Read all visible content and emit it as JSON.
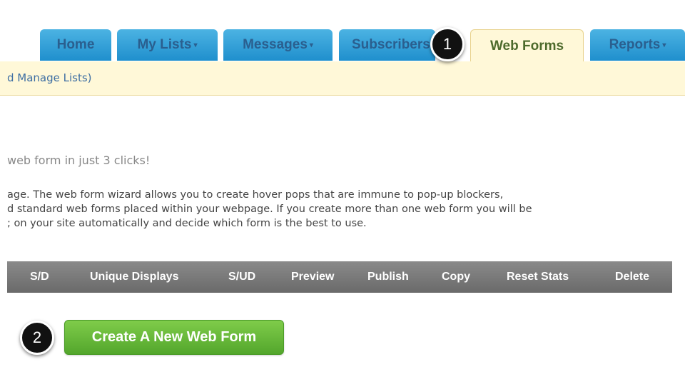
{
  "nav": {
    "tabs": [
      {
        "label": "Home"
      },
      {
        "label": "My Lists"
      },
      {
        "label": "Messages"
      },
      {
        "label": "Subscribers"
      },
      {
        "label": "Web Forms"
      },
      {
        "label": "Reports"
      }
    ],
    "caret": "▾",
    "subnav_text": "d Manage Lists)"
  },
  "content": {
    "heading": "web form in just 3 clicks!",
    "description_lines": [
      "age. The web form wizard allows you to create hover pops that are immune to pop-up blockers,",
      "d standard web forms placed within your webpage. If you create more than one web form you will be",
      "; on your site automatically and decide which form is the best to use."
    ]
  },
  "table": {
    "columns": [
      "S/D",
      "Unique Displays",
      "S/UD",
      "Preview",
      "Publish",
      "Copy",
      "Reset Stats",
      "Delete"
    ]
  },
  "create_button": {
    "label": "Create A New Web Form"
  },
  "callouts": [
    "1",
    "2"
  ],
  "colors": {
    "tab_blue": "#2f9fd8",
    "active_tab_bg": "#fff8d8",
    "button_green": "#66b83a",
    "table_header": "#777777"
  }
}
